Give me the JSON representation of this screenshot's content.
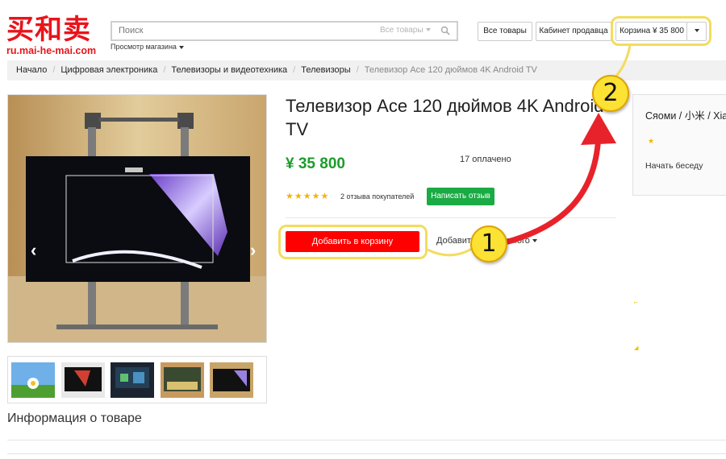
{
  "header": {
    "logo_cn": "买和卖",
    "logo_url": "ru.mai-he-mai.com",
    "search_placeholder": "Поиск",
    "search_category": "Все товары",
    "store_view": "Просмотр магазина",
    "btn_all_goods": "Все товары",
    "btn_seller_cabinet": "Кабинет продавца",
    "btn_cart": "Корзина ¥ 35 800"
  },
  "breadcrumb": {
    "items": [
      "Начало",
      "Цифровая электроника",
      "Телевизоры и видеотехника",
      "Телевизоры"
    ],
    "current": "Телевизор Ace 120 дюймов 4K Android TV"
  },
  "product": {
    "title": "Телевизор Ace 120 дюймов 4K Android TV",
    "price": "¥ 35 800",
    "paid_count": "17 оплачено",
    "stars": "★★★★★",
    "reviews": "2 отзыва покупателей",
    "write_review": "Написать отзыв",
    "add_to_cart": "Добавить в корзину",
    "wishlist": "Добавить в желаемого"
  },
  "seller": {
    "name": "Сяоми / 小米 / Xiaomi",
    "star": "★",
    "start_chat": "Начать беседу"
  },
  "info": {
    "title": "Информация о товаре"
  },
  "callouts": {
    "one": "1",
    "two": "2"
  },
  "colors": {
    "brand_red": "#e8141b",
    "add_to_cart": "#ff0000",
    "price_green": "#1b9c2a",
    "review_button": "#1aab44",
    "highlight": "#f3dc5f",
    "callout_fill": "#fbe233",
    "arrow_red": "#e8222a"
  }
}
